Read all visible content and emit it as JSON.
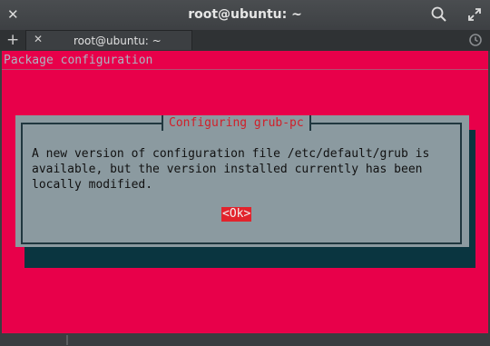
{
  "window": {
    "title": "root@ubuntu: ~",
    "close_glyph": "✕",
    "icons": {
      "search": "search-icon",
      "maximize": "maximize-icon"
    }
  },
  "tabs": {
    "add_glyph": "+",
    "items": [
      {
        "label": "root@ubuntu: ~",
        "close_glyph": "✕"
      }
    ],
    "history_icon": "history-icon"
  },
  "terminal": {
    "heading": "Package configuration",
    "background": "#e8004a",
    "dialog": {
      "title": "Configuring grub-pc",
      "message_lines": [
        "A new version of configuration file /etc/default/grub is",
        "available, but the version installed currently has been",
        "locally modified."
      ],
      "ok_label": "<Ok>"
    }
  }
}
